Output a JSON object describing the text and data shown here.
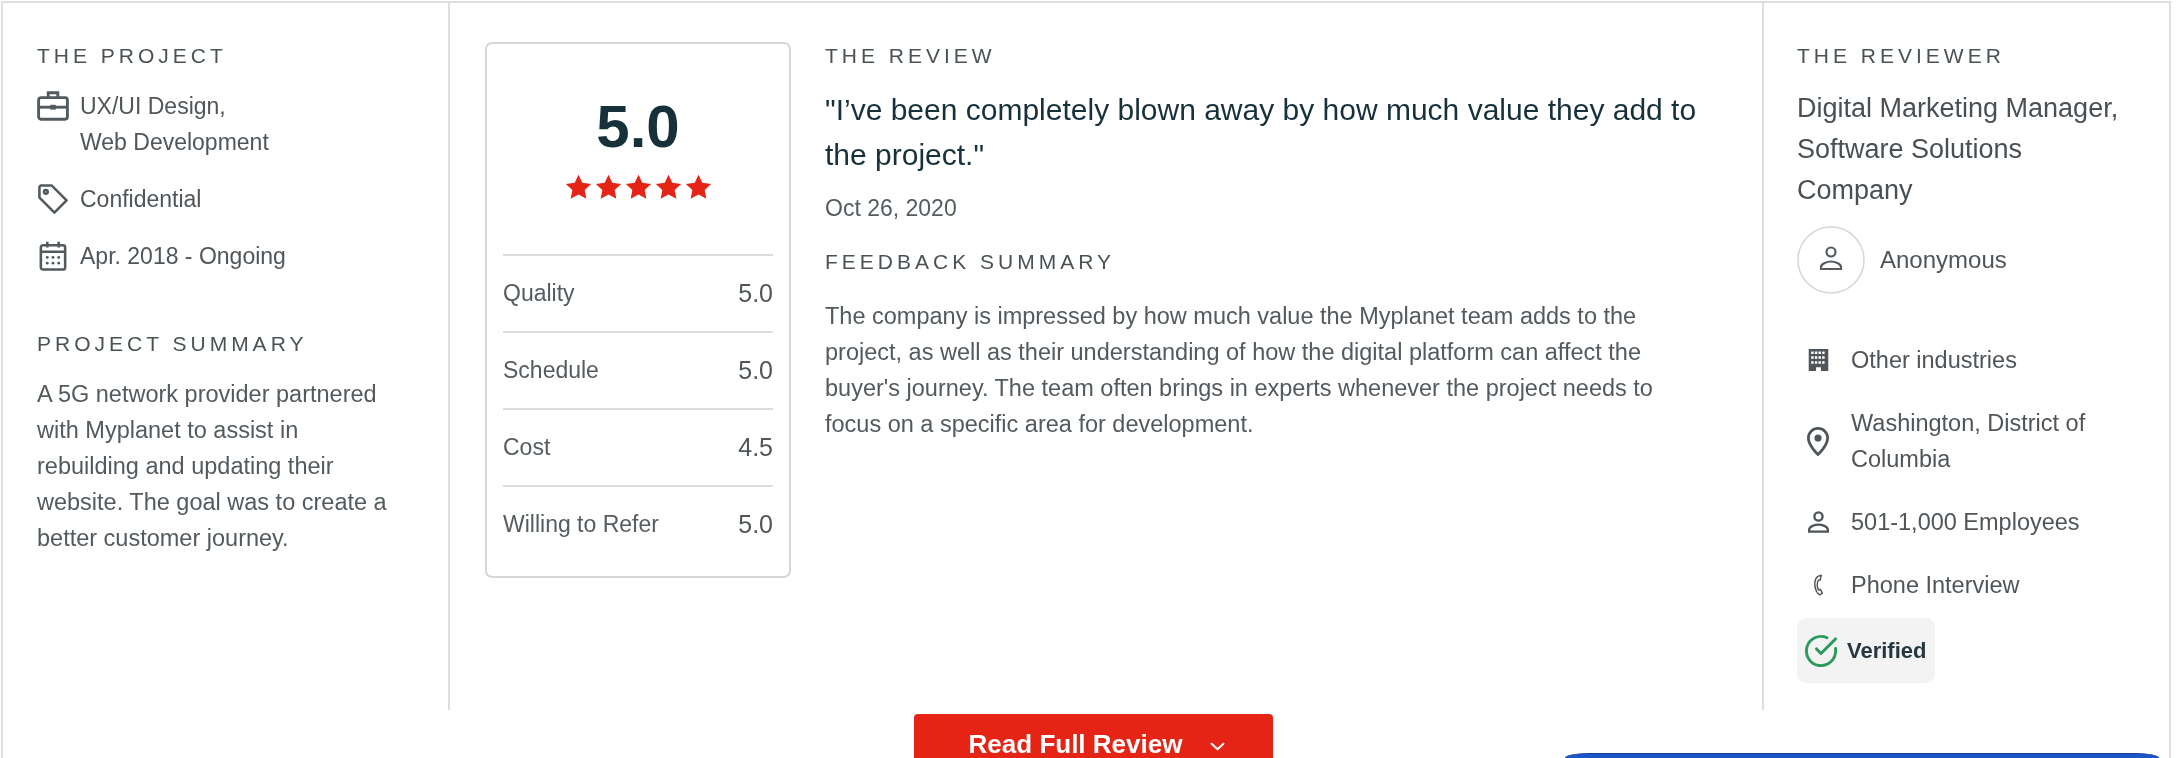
{
  "project": {
    "heading": "THE PROJECT",
    "details": [
      {
        "kind": "services",
        "lines": [
          "UX/UI Design,",
          "Web Development"
        ]
      },
      {
        "kind": "budget",
        "lines": [
          "Confidential"
        ]
      },
      {
        "kind": "timeline",
        "lines": [
          "Apr. 2018 - Ongoing"
        ]
      }
    ],
    "summary_heading": "PROJECT SUMMARY",
    "summary": "A 5G network provider partnered with Myplanet to assist in rebuilding and updating their website. The goal was to create a better customer journey."
  },
  "scores": {
    "overall": "5.0",
    "stars": 5,
    "rows": [
      {
        "label": "Quality",
        "value": "5.0"
      },
      {
        "label": "Schedule",
        "value": "5.0"
      },
      {
        "label": "Cost",
        "value": "4.5"
      },
      {
        "label": "Willing to Refer",
        "value": "5.0"
      }
    ]
  },
  "review": {
    "heading": "THE REVIEW",
    "quote": "\"I’ve been completely blown away by how much value they add to the project.\"",
    "date": "Oct 26, 2020",
    "feedback_heading": "FEEDBACK SUMMARY",
    "feedback": "The company is impressed by how much value the Myplanet team adds to the project, as well as their understanding of how the digital platform can affect the buyer's journey. The team often brings in experts whenever the project needs to focus on a specific area for development."
  },
  "reviewer": {
    "heading": "THE REVIEWER",
    "title": "Digital Marketing Manager, Software Solutions Company",
    "name": "Anonymous",
    "details": [
      {
        "kind": "industry",
        "text": "Other industries"
      },
      {
        "kind": "location",
        "text": "Washington, District of Columbia"
      },
      {
        "kind": "company_size",
        "text": "501-1,000 Employees"
      },
      {
        "kind": "interview",
        "text": "Phone Interview"
      }
    ],
    "verified_label": "Verified"
  },
  "read_more_button": {
    "label": "Read Full Review"
  }
}
